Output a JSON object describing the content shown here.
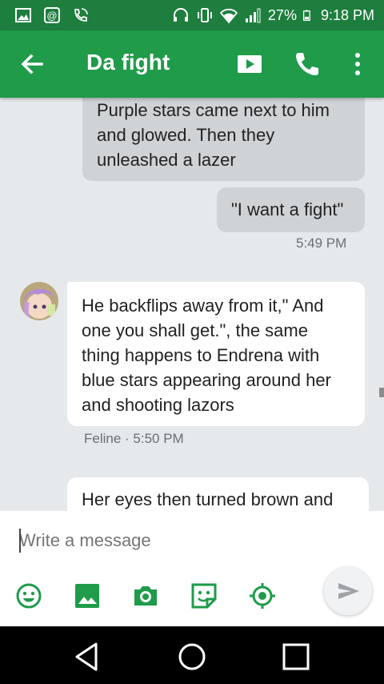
{
  "status_bar": {
    "battery": "27%",
    "time": "9:18 PM"
  },
  "app_bar": {
    "title": "Da fight",
    "icons": [
      "back-arrow-icon",
      "videocam-icon",
      "phone-icon",
      "more-vert-icon"
    ]
  },
  "messages": [
    {
      "type": "outgoing",
      "lines": [
        "Purple stars came next to him",
        "and glowed. Then they",
        "unleashed a lazer"
      ]
    },
    {
      "type": "outgoing",
      "text": "\"I want a fight\"",
      "time": "5:49 PM"
    },
    {
      "type": "incoming",
      "lines": [
        "He backflips away from it,\" And",
        "one you shall get.\", the same",
        "thing happens to Endrena with",
        "blue stars appearing around her",
        "and shooting lazors"
      ],
      "sender": "Feline",
      "time": "5:50 PM",
      "meta": "Feline · 5:50 PM"
    },
    {
      "type": "incoming",
      "lines": [
        "Her eyes then turned brown and"
      ]
    }
  ],
  "compose": {
    "placeholder": "Write a message",
    "tools": [
      "emoji-icon",
      "image-icon",
      "camera-icon",
      "sticker-icon",
      "location-icon"
    ],
    "send_icon": "send-icon"
  },
  "colors": {
    "status_bar": "#1e7e3e",
    "app_bar": "#1f9b4a",
    "outgoing_bubble": "#cfd3d6",
    "incoming_bubble": "#ffffff",
    "chat_background": "#e6e9eb"
  }
}
